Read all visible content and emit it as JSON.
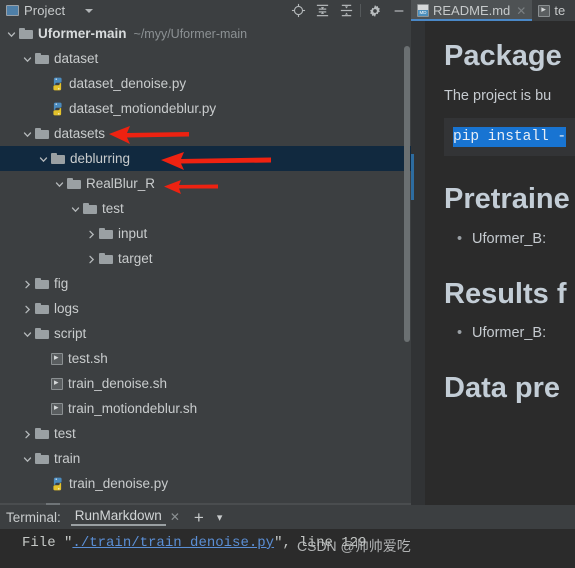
{
  "window": {
    "tool_window_title": "Project",
    "tool_window_icon": "project-panel-icon",
    "dropdown_icon": "chevron-down-icon"
  },
  "toolbar": {
    "buttons": [
      {
        "name": "locate-in-tree-icon",
        "label": "⊕"
      },
      {
        "name": "expand-all-icon",
        "label": "≡"
      },
      {
        "name": "collapse-all-icon",
        "label": "÷"
      },
      {
        "name": "settings-gear-icon",
        "label": "⚙"
      },
      {
        "name": "hide-panel-icon",
        "label": "−"
      }
    ]
  },
  "editor_tabs": [
    {
      "label": "README.md",
      "icon": "markdown-file-icon",
      "active": true,
      "close_icon": "close-icon"
    },
    {
      "label": "te",
      "icon": "shell-script-icon",
      "active": false,
      "close_icon": "close-icon"
    }
  ],
  "tree": {
    "root": {
      "name": "Uformer-main",
      "path": "~/myy/Uformer-main",
      "expanded": true,
      "icon": "folder-icon"
    },
    "items": [
      {
        "label": "dataset",
        "depth": 1,
        "type": "folder",
        "state": "expanded",
        "selected": false
      },
      {
        "label": "dataset_denoise.py",
        "depth": 2,
        "type": "python",
        "state": "leaf",
        "selected": false
      },
      {
        "label": "dataset_motiondeblur.py",
        "depth": 2,
        "type": "python",
        "state": "leaf",
        "selected": false
      },
      {
        "label": "datasets",
        "depth": 1,
        "type": "folder",
        "state": "expanded",
        "selected": false
      },
      {
        "label": "deblurring",
        "depth": 2,
        "type": "folder",
        "state": "expanded",
        "selected": true
      },
      {
        "label": "RealBlur_R",
        "depth": 3,
        "type": "folder",
        "state": "expanded",
        "selected": false
      },
      {
        "label": "test",
        "depth": 4,
        "type": "folder",
        "state": "expanded",
        "selected": false
      },
      {
        "label": "input",
        "depth": 5,
        "type": "folder",
        "state": "collapsed",
        "selected": false
      },
      {
        "label": "target",
        "depth": 5,
        "type": "folder",
        "state": "collapsed",
        "selected": false
      },
      {
        "label": "fig",
        "depth": 1,
        "type": "folder",
        "state": "collapsed",
        "selected": false
      },
      {
        "label": "logs",
        "depth": 1,
        "type": "folder",
        "state": "collapsed",
        "selected": false
      },
      {
        "label": "script",
        "depth": 1,
        "type": "folder",
        "state": "expanded",
        "selected": false
      },
      {
        "label": "test.sh",
        "depth": 2,
        "type": "shell",
        "state": "leaf",
        "selected": false
      },
      {
        "label": "train_denoise.sh",
        "depth": 2,
        "type": "shell",
        "state": "leaf",
        "selected": false
      },
      {
        "label": "train_motiondeblur.sh",
        "depth": 2,
        "type": "shell",
        "state": "leaf",
        "selected": false
      },
      {
        "label": "test",
        "depth": 1,
        "type": "folder",
        "state": "collapsed",
        "selected": false
      },
      {
        "label": "train",
        "depth": 1,
        "type": "folder",
        "state": "expanded",
        "selected": false
      },
      {
        "label": "train_denoise.py",
        "depth": 2,
        "type": "python",
        "state": "leaf",
        "selected": false
      }
    ]
  },
  "annotations": {
    "arrow_color": "#ee2211",
    "arrows": [
      {
        "name": "arrow-pointing-datasets",
        "target": "datasets"
      },
      {
        "name": "arrow-pointing-deblurring",
        "target": "deblurring"
      },
      {
        "name": "arrow-pointing-realblur-r",
        "target": "RealBlur_R"
      }
    ]
  },
  "preview": {
    "heading_1": "Package",
    "paragraph_1": "The project is bu",
    "run_icon": "run-gutter-icon",
    "code_1": "pip install -",
    "heading_2": "Pretraine",
    "bullet_1": "Uformer_B:",
    "heading_3": "Results f",
    "bullet_2": "Uformer_B:",
    "heading_4": "Data pre"
  },
  "terminal": {
    "label": "Terminal:",
    "tab": "RunMarkdown",
    "close_icon": "close-icon",
    "add_icon": "plus-icon",
    "list_icon": "chevron-down-icon",
    "output_prefix": "File \"",
    "output_link": "./train/train_denoise.py",
    "output_suffix": "\", line 129",
    "watermark": "CSDN @帅帅爱吃"
  },
  "colors": {
    "panel_bg": "#3c3f41",
    "editor_bg": "#2b2b2b",
    "selection_bg": "#11293f",
    "tab_active_underline": "#4a88c7",
    "link_blue": "#5b8fd6",
    "code_highlight": "#1874d2"
  }
}
